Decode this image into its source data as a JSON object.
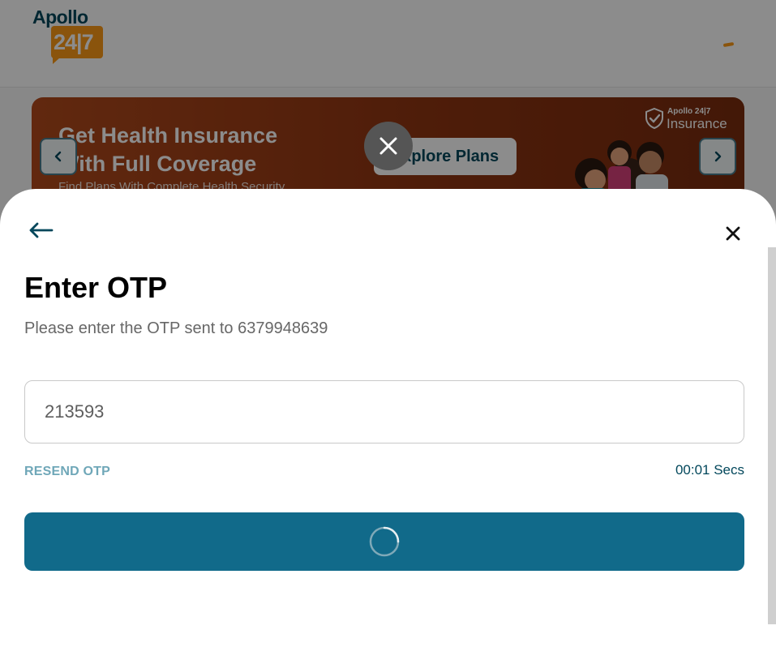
{
  "header": {
    "logo_top": "Apollo",
    "logo_bottom": "24|7",
    "accent_color": "#fc9916",
    "brand_color": "#02475b"
  },
  "banner": {
    "title_line1": "Get Health Insurance",
    "title_line2": "With Full Coverage",
    "subtitle": "Find Plans With Complete Health Security",
    "cta_label": "Explore Plans",
    "brand_top": "Apollo 24|7",
    "brand_main": "Insurance"
  },
  "icons": {
    "prev": "chevron-left-icon",
    "next": "chevron-right-icon",
    "close_float": "close-icon",
    "back": "arrow-left-icon",
    "close": "close-icon",
    "loading": "spinner-icon"
  },
  "otp_sheet": {
    "title": "Enter OTP",
    "subtitle": "Please enter the OTP sent to 6379948639",
    "otp_value": "213593",
    "resend_label": "RESEND OTP",
    "timer_text": "00:01 Secs",
    "button_color": "#116a8a"
  }
}
